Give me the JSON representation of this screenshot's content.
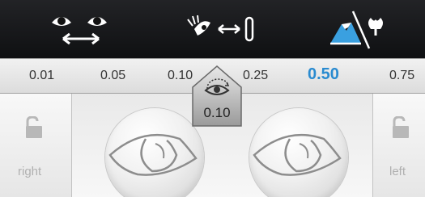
{
  "toolbar": {
    "buttons": [
      {
        "name": "pupillary-distance",
        "icon": "two-eyes-distance-icon"
      },
      {
        "name": "vertex-distance",
        "icon": "eye-to-lens-distance-icon"
      },
      {
        "name": "distance-mode",
        "icon": "mountain-flower-icon",
        "active_color": "#3aa0e0"
      }
    ]
  },
  "scale": {
    "values": [
      "0.01",
      "0.05",
      "0.10",
      "0.25",
      "0.50",
      "0.75"
    ],
    "selected": "0.50",
    "selected_color": "#2a8bd0"
  },
  "marker": {
    "icon": "eye-measure-icon",
    "value": "0.10"
  },
  "panel": {
    "right_label": "right",
    "left_label": "left",
    "lock_icon": "unlocked-padlock-icon"
  }
}
